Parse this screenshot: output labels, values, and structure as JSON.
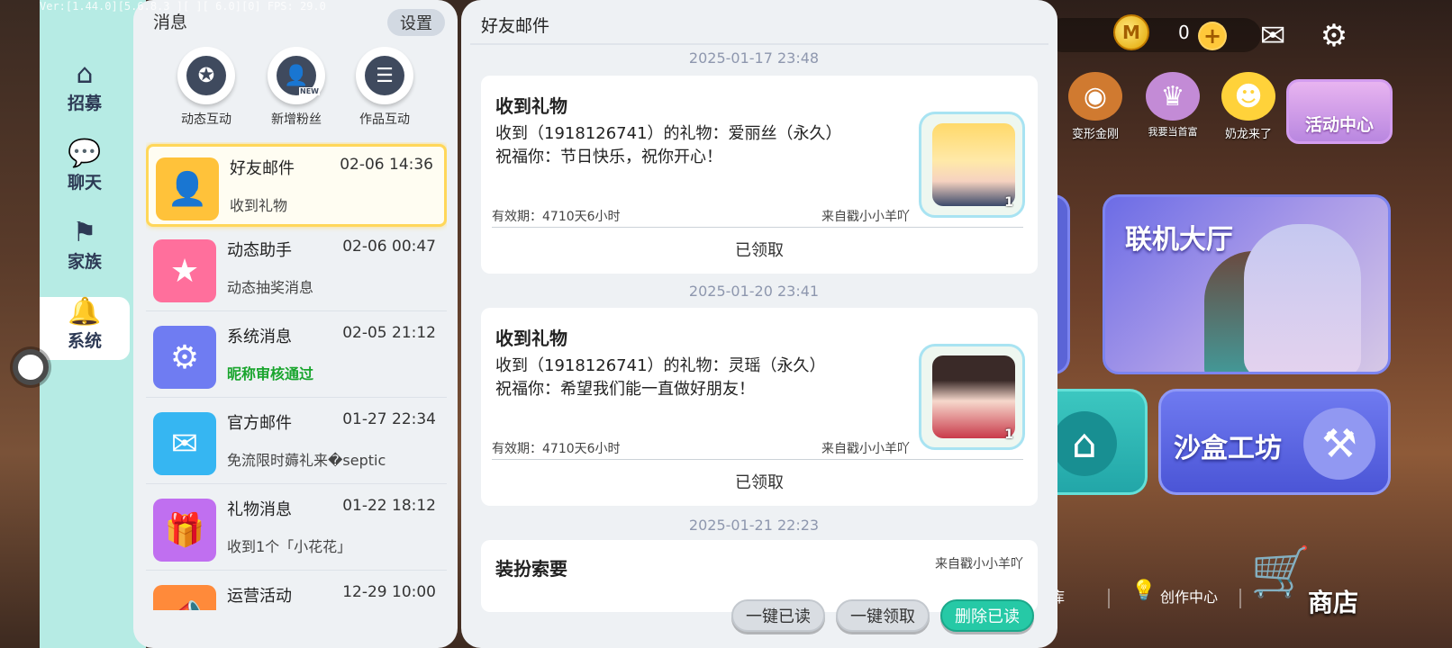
{
  "debug_text": "Ver:[1.44.0][5.6.8.3  ][  ][  6.0][0] FPS: 29.0",
  "nav": {
    "items": [
      {
        "label": "招募",
        "icon": "house-icon"
      },
      {
        "label": "聊天",
        "icon": "chat-bubble-icon"
      },
      {
        "label": "家族",
        "icon": "flag-icon"
      },
      {
        "label": "系统",
        "icon": "bell-icon",
        "active": true
      }
    ]
  },
  "messages_panel": {
    "title": "消息",
    "settings_label": "设置",
    "quick_actions": [
      {
        "label": "动态互动",
        "icon": "star-bubble-icon"
      },
      {
        "label": "新增粉丝",
        "icon": "new-follower-icon",
        "badge": "NEW"
      },
      {
        "label": "作品互动",
        "icon": "list-icon"
      }
    ],
    "rows": [
      {
        "title": "好友邮件",
        "time": "02-06 14:36",
        "sub": "收到礼物",
        "icon": "friend-mail-icon",
        "color": "#ffc23a",
        "selected": true
      },
      {
        "title": "动态助手",
        "time": "02-06 00:47",
        "sub": "动态抽奖消息",
        "icon": "bookmark-star-icon",
        "color": "#ff6f9c"
      },
      {
        "title": "系统消息",
        "time": "02-05 21:12",
        "sub": "昵称审核通过",
        "icon": "gear-icon",
        "color": "#6f7cf2",
        "highlight": true
      },
      {
        "title": "官方邮件",
        "time": "01-27 22:34",
        "sub": "免流限时薅礼来�septic",
        "icon": "envelope-icon",
        "color": "#36b6f2"
      },
      {
        "title": "礼物消息",
        "time": "01-22 18:12",
        "sub": "收到1个「小花花」",
        "icon": "gift-icon",
        "color": "#c06ff0"
      },
      {
        "title": "运营活动",
        "time": "12-29 10:00",
        "sub": "",
        "icon": "megaphone-icon",
        "color": "#ff8a3a"
      }
    ]
  },
  "mail_panel": {
    "title": "好友邮件",
    "entries": [
      {
        "date": "2025-01-17 23:48",
        "heading": "收到礼物",
        "line1": "收到（1918126741）的礼物：爱丽丝（永久）",
        "line2": "祝福你：节日快乐，祝你开心！",
        "expiry": "有效期：4710天6小时",
        "from": "来自戳小小羊吖",
        "status": "已领取",
        "count": "1"
      },
      {
        "date": "2025-01-20 23:41",
        "heading": "收到礼物",
        "line1": "收到（1918126741）的礼物：灵瑶（永久）",
        "line2": "祝福你：希望我们能一直做好朋友！",
        "expiry": "有效期：4710天6小时",
        "from": "来自戳小小羊吖",
        "status": "已领取",
        "count": "1"
      },
      {
        "date": "2025-01-21 22:23",
        "heading": "装扮索要",
        "from": "来自戳小小羊吖"
      }
    ],
    "buttons": {
      "read_all": "一键已读",
      "claim_all": "一键领取",
      "delete_read": "删除已读"
    }
  },
  "game_hud": {
    "coins": "0",
    "activities": [
      {
        "label": "变形金刚"
      },
      {
        "label": "我要当首富"
      },
      {
        "label": "奶龙来了"
      }
    ],
    "activity_center": "活动中心",
    "lobby": "联机大厅",
    "sandbox": "沙盒工坊",
    "bottom": {
      "library": "库",
      "creator": "创作中心",
      "shop": "商店"
    }
  }
}
